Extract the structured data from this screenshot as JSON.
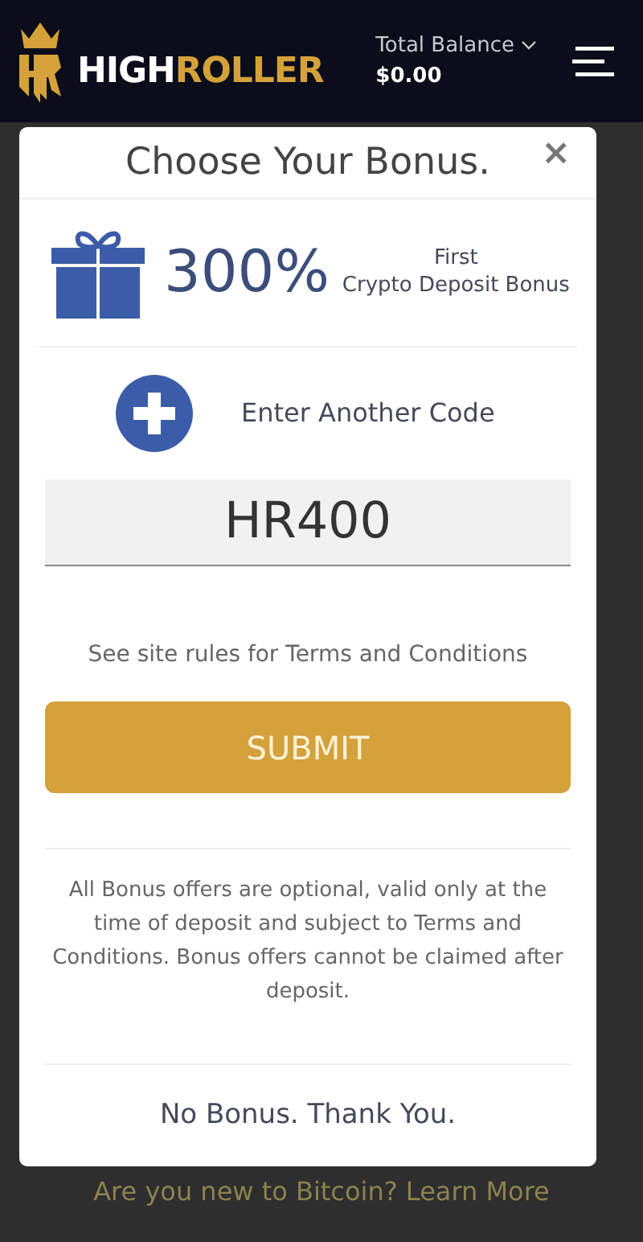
{
  "header": {
    "logo_prefix": "HIGH",
    "logo_suffix": "ROLLER",
    "balance_label": "Total Balance",
    "balance": "$0.00"
  },
  "modal": {
    "title": "Choose Your Bonus.",
    "close": "×",
    "bonus": {
      "amount": "300%",
      "line1": "First",
      "line2": "Crypto Deposit Bonus"
    },
    "another_code": "Enter Another Code",
    "code_field": {
      "value": "HR400"
    },
    "terms": "See site rules for Terms and Conditions",
    "submit": "SUBMIT",
    "disclaimer": "All Bonus offers are optional, valid only at the time of deposit and subject to Terms and Conditions. Bonus offers cannot be claimed after deposit.",
    "no_bonus": "No Bonus. Thank You."
  },
  "background_link": "Are you new to Bitcoin? Learn More"
}
